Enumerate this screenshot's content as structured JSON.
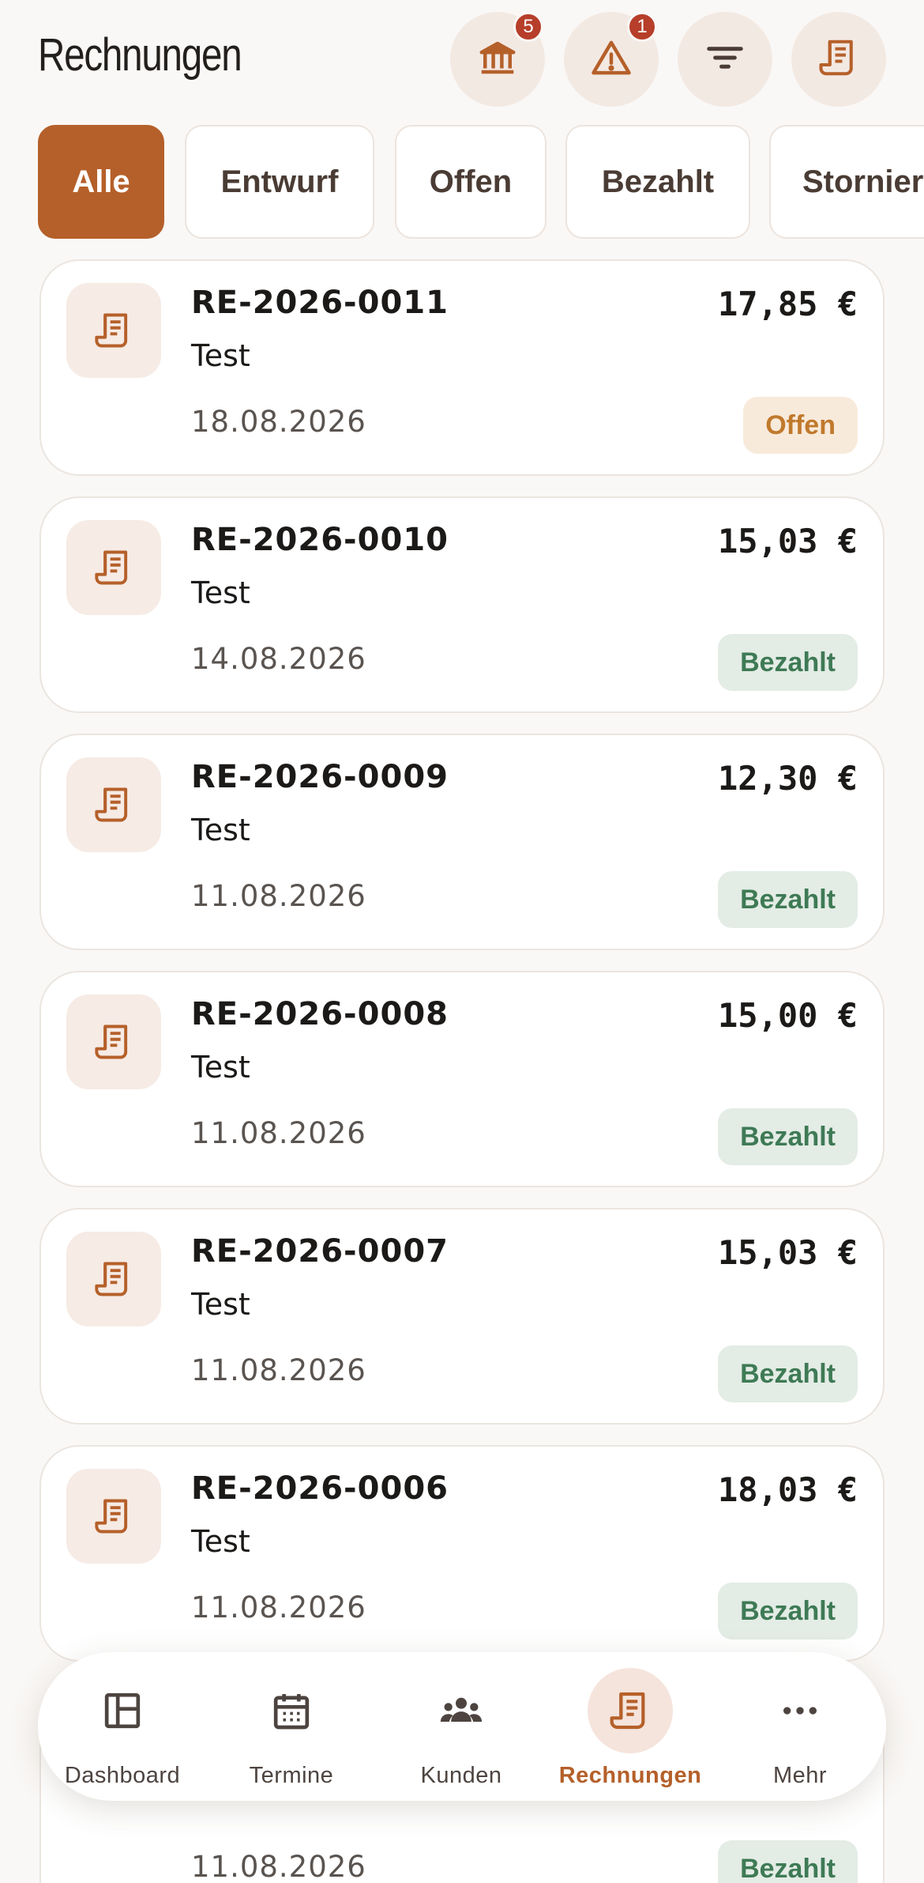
{
  "header": {
    "title": "Rechnungen",
    "buttons": [
      {
        "icon": "bank-icon",
        "badge": "5"
      },
      {
        "icon": "warning-icon",
        "badge": "1"
      },
      {
        "icon": "filter-icon",
        "badge": null
      },
      {
        "icon": "receipt-icon",
        "badge": null
      }
    ]
  },
  "filters": [
    "Alle",
    "Entwurf",
    "Offen",
    "Bezahlt",
    "Storniert"
  ],
  "active_filter": "Alle",
  "invoices": [
    {
      "number": "RE-2026-0011",
      "description": "Test",
      "date": "18.08.2026",
      "amount": "17,85 €",
      "status": "Offen"
    },
    {
      "number": "RE-2026-0010",
      "description": "Test",
      "date": "14.08.2026",
      "amount": "15,03 €",
      "status": "Bezahlt"
    },
    {
      "number": "RE-2026-0009",
      "description": "Test",
      "date": "11.08.2026",
      "amount": "12,30 €",
      "status": "Bezahlt"
    },
    {
      "number": "RE-2026-0008",
      "description": "Test",
      "date": "11.08.2026",
      "amount": "15,00 €",
      "status": "Bezahlt"
    },
    {
      "number": "RE-2026-0007",
      "description": "Test",
      "date": "11.08.2026",
      "amount": "15,03 €",
      "status": "Bezahlt"
    },
    {
      "number": "RE-2026-0006",
      "description": "Test",
      "date": "11.08.2026",
      "amount": "18,03 €",
      "status": "Bezahlt"
    },
    {
      "date": "11.08.2026",
      "status": "Bezahlt"
    }
  ],
  "nav": [
    {
      "label": "Dashboard",
      "icon": "dashboard-icon"
    },
    {
      "label": "Termine",
      "icon": "calendar-icon"
    },
    {
      "label": "Kunden",
      "icon": "customers-icon"
    },
    {
      "label": "Rechnungen",
      "icon": "receipt-icon",
      "active": true
    },
    {
      "label": "Mehr",
      "icon": "more-icon"
    }
  ],
  "colors": {
    "accent": "#b5602a",
    "background": "#faf8f6",
    "badge": "#b63e2a",
    "status_open_bg": "#f8eadb",
    "status_open_text": "#c0792c",
    "status_paid_bg": "#e3ece5",
    "status_paid_text": "#3e7a55"
  }
}
